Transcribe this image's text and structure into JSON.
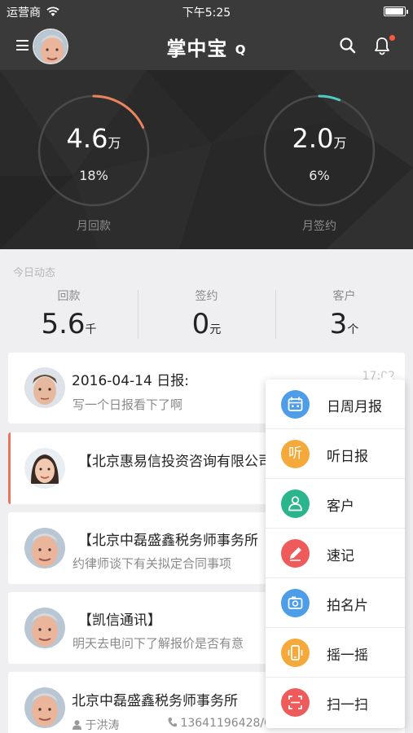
{
  "status_bar": {
    "carrier": "运营商",
    "time": "下午5:25"
  },
  "nav": {
    "logo_text": "掌中宝",
    "logo_mark": "Q"
  },
  "summary": {
    "left": {
      "value": "4.6",
      "unit": "万",
      "percent": "18%",
      "label": "月回款",
      "progress": 0.18,
      "color": "#e9845f"
    },
    "right": {
      "value": "2.0",
      "unit": "万",
      "percent": "6%",
      "label": "月签约",
      "progress": 0.06,
      "color": "#4ecdc4"
    }
  },
  "today": {
    "title": "今日动态",
    "stats": [
      {
        "label": "回款",
        "value": "5.6",
        "unit": "千"
      },
      {
        "label": "签约",
        "value": "0",
        "unit": "元"
      },
      {
        "label": "客户",
        "value": "3",
        "unit": "个"
      }
    ]
  },
  "feed": [
    {
      "title": "2016-04-14 日报:",
      "subtitle": "写一个日报看下了啊",
      "time": "17:02"
    },
    {
      "title": "【北京惠易信投资咨询有限公司",
      "subtitle": ""
    },
    {
      "title": "【北京中磊盛鑫税务师事务所",
      "subtitle": "约律师谈下有关拟定合同事项"
    },
    {
      "title": "【凯信通讯】",
      "subtitle": "明天去电问下了解报价是否有意"
    },
    {
      "title": "北京中磊盛鑫税务师事务所",
      "contact_name": "于洪涛",
      "contact_phone": "13641196428/0106226..."
    }
  ],
  "popup_menu": [
    {
      "label": "日周月报",
      "icon": "calendar-icon",
      "color": "#4d9de8"
    },
    {
      "label": "听日报",
      "icon": "listen-icon",
      "color": "#f6a93b",
      "icon_text": "听"
    },
    {
      "label": "客户",
      "icon": "customer-icon",
      "color": "#2bb58c"
    },
    {
      "label": "速记",
      "icon": "pencil-icon",
      "color": "#ef5a5a"
    },
    {
      "label": "拍名片",
      "icon": "camera-icon",
      "color": "#4d9de8"
    },
    {
      "label": "摇一摇",
      "icon": "shake-icon",
      "color": "#f6a93b"
    },
    {
      "label": "扫一扫",
      "icon": "scan-icon",
      "color": "#ef5a5a"
    }
  ]
}
